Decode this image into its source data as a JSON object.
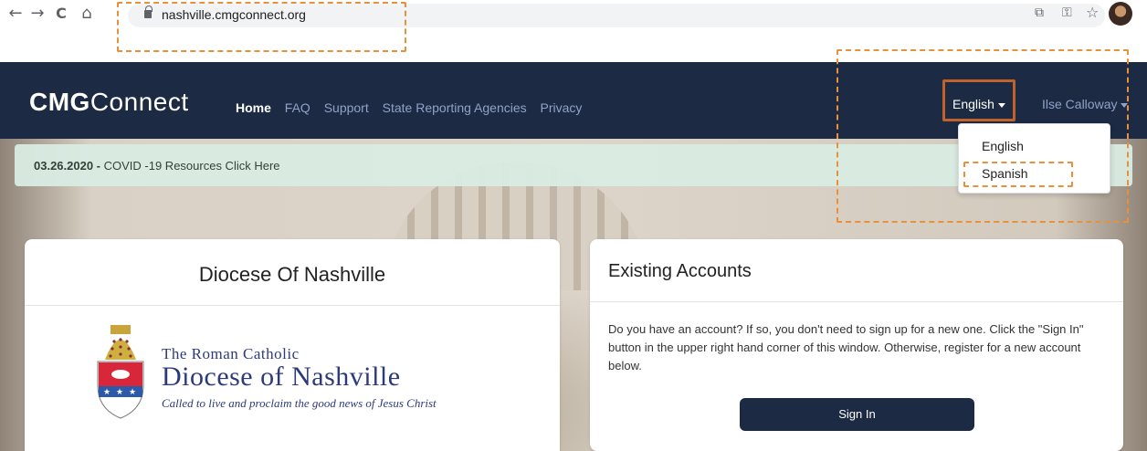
{
  "browser": {
    "url": "nashville.cmgconnect.org",
    "back_glyph": "←",
    "forward_glyph": "→",
    "reload_glyph": "C",
    "home_glyph": "⌂",
    "cast_glyph": "⧉",
    "key_glyph": "⚿",
    "star_glyph": "☆"
  },
  "navbar": {
    "brand_bold": "CMG",
    "brand_light": "Connect",
    "links": [
      "Home",
      "FAQ",
      "Support",
      "State Reporting Agencies",
      "Privacy"
    ],
    "language_label": "English",
    "user_label": "Ilse Calloway"
  },
  "language_menu": {
    "options": [
      "English",
      "Spanish"
    ]
  },
  "announcement": {
    "date": "03.26.2020 -",
    "text": " COVID -19 Resources Click Here"
  },
  "diocese_card": {
    "title": "Diocese Of Nashville",
    "logo_line1": "The Roman Catholic",
    "logo_line2": "Diocese of Nashville",
    "logo_tagline": "Called to live and proclaim the good news of Jesus Christ"
  },
  "accounts_card": {
    "title": "Existing Accounts",
    "body": "Do you have an account? If so, you don't need to sign up for a new one. Click the \"Sign In\" button in the upper right hand corner of this window. Otherwise, register for a new account below.",
    "signin_label": "Sign In"
  },
  "colors": {
    "navbar": "#1c2a44",
    "annotation": "#e8913a",
    "announcement_bg": "#d9ece3"
  }
}
